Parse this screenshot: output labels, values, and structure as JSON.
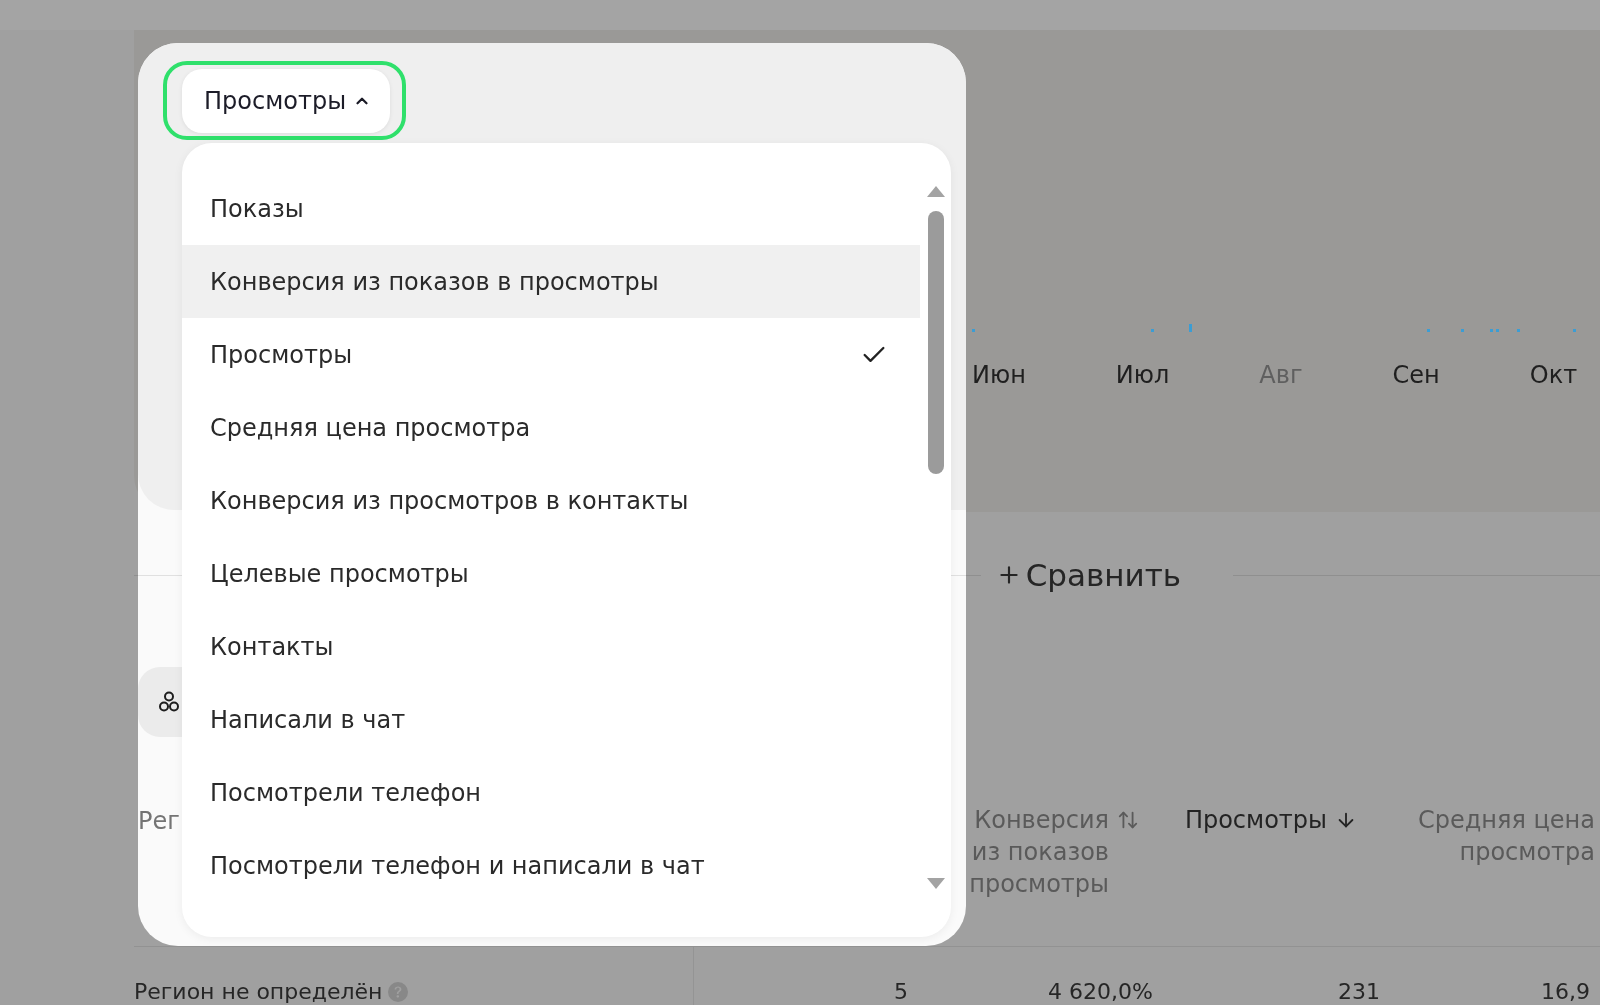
{
  "metric_selector": {
    "label": "Просмотры",
    "expanded": true,
    "highlighted": true
  },
  "metric_menu": {
    "items": [
      {
        "label": "Показы",
        "hovered": false,
        "selected": false
      },
      {
        "label": "Конверсия из показов в просмотры",
        "hovered": true,
        "selected": false
      },
      {
        "label": "Просмотры",
        "hovered": false,
        "selected": true
      },
      {
        "label": "Средняя цена просмотра",
        "hovered": false,
        "selected": false
      },
      {
        "label": "Конверсия из просмотров в контакты",
        "hovered": false,
        "selected": false
      },
      {
        "label": "Целевые просмотры",
        "hovered": false,
        "selected": false
      },
      {
        "label": "Контакты",
        "hovered": false,
        "selected": false
      },
      {
        "label": "Написали в чат",
        "hovered": false,
        "selected": false
      },
      {
        "label": "Посмотрели телефон",
        "hovered": false,
        "selected": false
      },
      {
        "label": "Посмотрели телефон и написали в чат",
        "hovered": false,
        "selected": false
      }
    ]
  },
  "chart": {
    "months": [
      {
        "label": "Июн",
        "muted": false
      },
      {
        "label": "Июл",
        "muted": false
      },
      {
        "label": "Авг",
        "muted": true
      },
      {
        "label": "Сен",
        "muted": false
      },
      {
        "label": "Окт",
        "muted": false
      }
    ]
  },
  "compare_button": {
    "label": "Сравнить"
  },
  "table": {
    "columns": [
      {
        "lines": [
          "Рег"
        ]
      },
      {
        "lines": [
          "Конверсия",
          "из показов",
          "просмотры"
        ],
        "sortable": true,
        "sorted": false
      },
      {
        "lines": [
          "Просмотры"
        ],
        "sortable": true,
        "sorted": true
      },
      {
        "lines": [
          "Средняя цена",
          "просмотра"
        ],
        "sortable": false,
        "sorted": false
      }
    ],
    "rows": [
      {
        "region": "Регион не определён",
        "cells": [
          "5",
          "4 620,0%",
          "231",
          "16,9"
        ]
      }
    ]
  }
}
